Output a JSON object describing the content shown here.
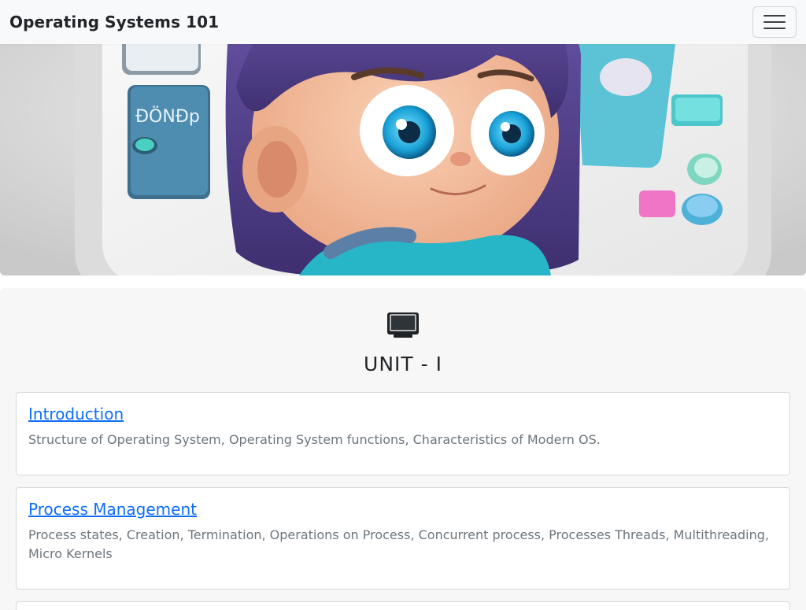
{
  "navbar": {
    "brand": "Operating Systems 101",
    "toggle_icon": "hamburger-menu-icon"
  },
  "hero": {
    "image": "cartoon-girl-with-computer-illustration",
    "colors": {
      "hair": "#5a4590",
      "eyes": "#1aa3d8",
      "shirt": "#27b6c8",
      "skin": "#f2b592",
      "device": "#4f8db0"
    }
  },
  "unit": {
    "icon": "monitor-icon",
    "title": "UNIT - I",
    "topics": [
      {
        "title": "Introduction",
        "description": "Structure of Operating System, Operating System functions, Characteristics of Modern OS."
      },
      {
        "title": "Process Management",
        "description": "Process states, Creation, Termination, Operations on Process, Concurrent process, Processes Threads, Multithreading, Micro Kernels"
      }
    ]
  },
  "colors": {
    "link": "#0d6efd",
    "muted_text": "#6c757d",
    "navbar_bg": "#f8f9fa",
    "card_bg": "#f7f7f7"
  }
}
